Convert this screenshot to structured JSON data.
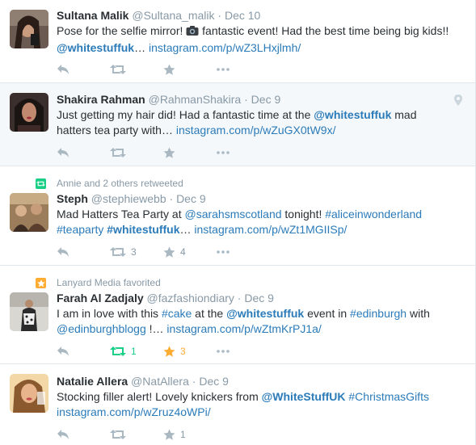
{
  "tweets": [
    {
      "fullname": "Sultana Malik",
      "username": "@Sultana_malik",
      "time": "Dec 10",
      "text_a": "Pose for the selfie mirror! ",
      "text_b": " fantastic event! Had the best time being big kids!!",
      "mention": "@whitestuffuk",
      "mention_suffix": "…",
      "link": "instagram.com/p/wZ3LHxjlmh/"
    },
    {
      "fullname": "Shakira Rahman",
      "username": "@RahmanShakira",
      "time": "Dec 9",
      "text_a": "Just getting my hair did! Had a fantastic time at the ",
      "mention": "@whitestuffuk",
      "text_b": "  mad",
      "text_c": "hatters tea party with… ",
      "link": "instagram.com/p/wZuGX0tW9x/"
    },
    {
      "context": "Annie and 2 others retweeted",
      "fullname": "Steph",
      "username": "@stephiewebb",
      "time": "Dec 9",
      "text_a": "Mad Hatters Tea Party at ",
      "mention": "@sarahsmscotland",
      "text_b": " tonight! ",
      "hashtag1": "#aliceinwonderland",
      "hashtag2": "#teaparty",
      "hashtag3": "#whitestuffuk",
      "ellipsis": "… ",
      "link": "instagram.com/p/wZt1MGIISp/",
      "retweets": "3",
      "favorites": "4"
    },
    {
      "context": "Lanyard Media favorited",
      "fullname": "Farah Al Zadjaly",
      "username": "@fazfashiondiary",
      "time": "Dec 9",
      "text_a": "I am in love with this ",
      "hashtag1": "#cake",
      "text_b": " at the ",
      "mention": "@whitestuffuk",
      "text_c": " event in ",
      "hashtag2": "#edinburgh",
      "text_d": " with",
      "mention2": "@edinburghblogg",
      "text_e": " !… ",
      "link": "instagram.com/p/wZtmKrPJ1a/",
      "retweets": "1",
      "favorites": "3"
    },
    {
      "fullname": "Natalie Allera",
      "username": "@NatAllera",
      "time": "Dec 9",
      "text_a": "Stocking filler alert! Lovely knickers from ",
      "mention": "@WhiteStuffUK",
      "hashtag1": "#ChristmasGifts",
      "link": "instagram.com/p/wZruz4oWPi/",
      "favorites": "1"
    }
  ],
  "separator_dot": "·",
  "colors": {
    "link": "#2b7bb9",
    "meta": "#8899a6",
    "action": "#aab8c2",
    "retweet_active": "#19cf86",
    "favorite_active": "#ffac33"
  },
  "icons": [
    "reply-icon",
    "retweet-icon",
    "favorite-icon",
    "camera-icon",
    "location-pin-icon"
  ]
}
